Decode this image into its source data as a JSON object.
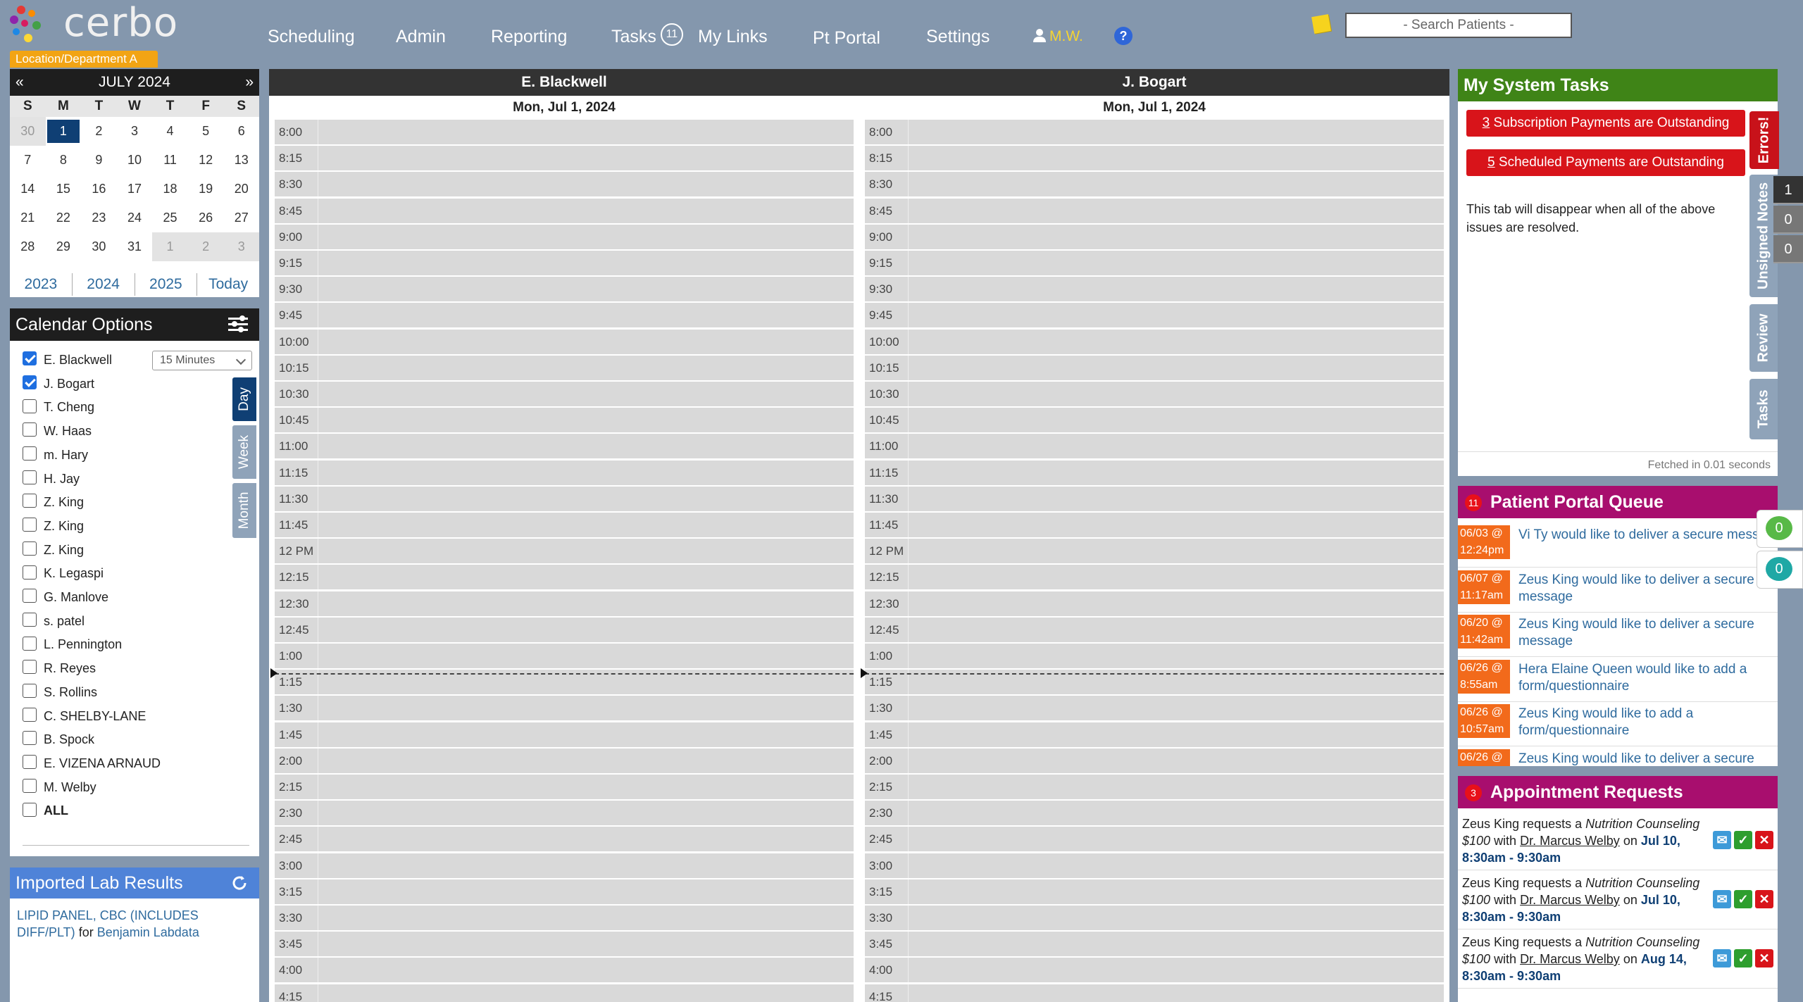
{
  "app": {
    "name": "cerbo",
    "department": "Location/Department A"
  },
  "nav": {
    "scheduling": "Scheduling",
    "admin": "Admin",
    "reporting": "Reporting",
    "tasks": "Tasks",
    "tasks_count": "11",
    "my_links": "My Links",
    "pt_portal": "Pt Portal",
    "settings": "Settings",
    "user": "M.W.",
    "help": "?"
  },
  "search": {
    "placeholder": "- Search Patients -"
  },
  "calendar": {
    "month_label": "JULY 2024",
    "prev": "«",
    "next": "»",
    "weekdays": [
      "S",
      "M",
      "T",
      "W",
      "T",
      "F",
      "S"
    ],
    "days": [
      "30",
      "1",
      "2",
      "3",
      "4",
      "5",
      "6",
      "7",
      "8",
      "9",
      "10",
      "11",
      "12",
      "13",
      "14",
      "15",
      "16",
      "17",
      "18",
      "19",
      "20",
      "21",
      "22",
      "23",
      "24",
      "25",
      "26",
      "27",
      "28",
      "29",
      "30",
      "31",
      "1",
      "2",
      "3"
    ],
    "years": [
      "2023",
      "2024",
      "2025",
      "Today"
    ]
  },
  "calendar_options": {
    "title": "Calendar Options",
    "interval": "15 Minutes",
    "view_tabs": [
      "Day",
      "Week",
      "Month"
    ],
    "providers": [
      {
        "name": "E. Blackwell",
        "checked": true
      },
      {
        "name": "J. Bogart",
        "checked": true
      },
      {
        "name": "T. Cheng",
        "checked": false
      },
      {
        "name": "W. Haas",
        "checked": false
      },
      {
        "name": "m. Hary",
        "checked": false
      },
      {
        "name": "H. Jay",
        "checked": false
      },
      {
        "name": "Z. King",
        "checked": false
      },
      {
        "name": "Z. King",
        "checked": false
      },
      {
        "name": "Z. King",
        "checked": false
      },
      {
        "name": "K. Legaspi",
        "checked": false
      },
      {
        "name": "G. Manlove",
        "checked": false
      },
      {
        "name": "s. patel",
        "checked": false
      },
      {
        "name": "L. Pennington",
        "checked": false
      },
      {
        "name": "R. Reyes",
        "checked": false
      },
      {
        "name": "S. Rollins",
        "checked": false
      },
      {
        "name": "C. SHELBY-LANE",
        "checked": false
      },
      {
        "name": "B. Spock",
        "checked": false
      },
      {
        "name": "E. VIZENA ARNAUD",
        "checked": false
      },
      {
        "name": "M. Welby",
        "checked": false
      },
      {
        "name": "ALL",
        "checked": false
      }
    ]
  },
  "lab_results": {
    "title": "Imported Lab Results",
    "item_test": "LIPID PANEL, CBC (INCLUDES DIFF/PLT)",
    "item_for": "for",
    "item_patient": "Benjamin Labdata"
  },
  "schedule": {
    "columns": [
      {
        "provider": "E. Blackwell",
        "date": "Mon, Jul 1, 2024"
      },
      {
        "provider": "J. Bogart",
        "date": "Mon, Jul 1, 2024"
      }
    ],
    "times": [
      "8:00",
      "8:15",
      "8:30",
      "8:45",
      "9:00",
      "9:15",
      "9:30",
      "9:45",
      "10:00",
      "10:15",
      "10:30",
      "10:45",
      "11:00",
      "11:15",
      "11:30",
      "11:45",
      "12 PM",
      "12:15",
      "12:30",
      "12:45",
      "1:00",
      "1:15",
      "1:30",
      "1:45",
      "2:00",
      "2:15",
      "2:30",
      "2:45",
      "3:00",
      "3:15",
      "3:30",
      "3:45",
      "4:00",
      "4:15"
    ]
  },
  "system_tasks": {
    "title": "My System Tasks",
    "alerts": [
      {
        "count": "3",
        "text": "Subscription Payments are Outstanding"
      },
      {
        "count": "5",
        "text": "Scheduled Payments are Outstanding"
      }
    ],
    "note": "This tab will disappear when all of the above issues are resolved.",
    "fetched": "Fetched in 0.01 seconds",
    "side_tabs": {
      "errors": "Errors!",
      "unsigned_notes": "Unsigned Notes",
      "review": "Review",
      "tasks": "Tasks"
    },
    "counts": [
      "1",
      "0",
      "0"
    ]
  },
  "portal_queue": {
    "title": "Patient Portal Queue",
    "badge": "11",
    "items": [
      {
        "date": "06/03 @",
        "time": "12:24pm",
        "text": "Vi Ty would like to deliver a secure message"
      },
      {
        "date": "06/07 @",
        "time": "11:17am",
        "text": "Zeus King would like to deliver a secure message"
      },
      {
        "date": "06/20 @",
        "time": "11:42am",
        "text": "Zeus King would like to deliver a secure message"
      },
      {
        "date": "06/26 @",
        "time": "8:55am",
        "text": "Hera Elaine Queen would like to add a form/questionnaire"
      },
      {
        "date": "06/26 @",
        "time": "10:57am",
        "text": "Zeus King would like to add a form/questionnaire"
      },
      {
        "date": "06/26 @",
        "time": "",
        "text": "Zeus King would like to deliver a secure"
      }
    ],
    "bubbles": [
      "0",
      "0"
    ]
  },
  "appointment_requests": {
    "title": "Appointment Requests",
    "badge": "3",
    "items": [
      {
        "patient": "Zeus King",
        "verb": "requests a",
        "service": "Nutrition Counseling $100",
        "with": "with",
        "doctor": "Dr. Marcus Welby",
        "on": "on",
        "when": "Jul 10, 8:30am - 9:30am"
      },
      {
        "patient": "Zeus King",
        "verb": "requests a",
        "service": "Nutrition Counseling $100",
        "with": "with",
        "doctor": "Dr. Marcus Welby",
        "on": "on",
        "when": "Jul 10, 8:30am - 9:30am"
      },
      {
        "patient": "Zeus King",
        "verb": "requests a",
        "service": "Nutrition Counseling $100",
        "with": "with",
        "doctor": "Dr. Marcus Welby",
        "on": "on",
        "when": "Aug 14, 8:30am - 9:30am"
      }
    ]
  },
  "colors": {
    "header_bg": "#8497ad",
    "accent_green": "#3f8417",
    "accent_magenta": "#a80e6e",
    "alert_red": "#d8141a",
    "date_orange": "#f26a1b",
    "calendar_selected": "#0f3f74"
  }
}
